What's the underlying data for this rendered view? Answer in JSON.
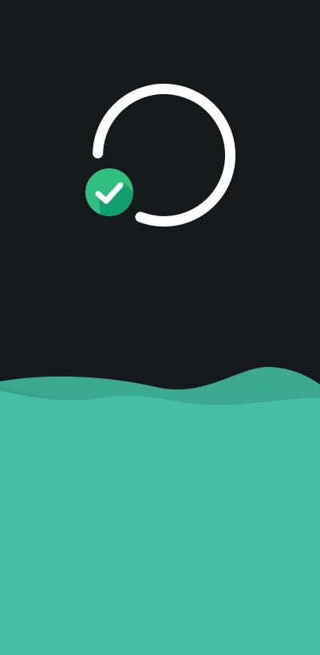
{
  "colors": {
    "background": "#16191c",
    "ring": "#ffffff",
    "check_badge_light": "#2fbf7e",
    "check_badge_dark": "#119f6f",
    "check_mark": "#ffffff",
    "wave_base": "#45bea3",
    "wave_shadow": "#37a087",
    "wave_back": "#3aa98f"
  },
  "icons": {
    "status": "check-circle-icon",
    "progress": "progress-ring-icon"
  }
}
